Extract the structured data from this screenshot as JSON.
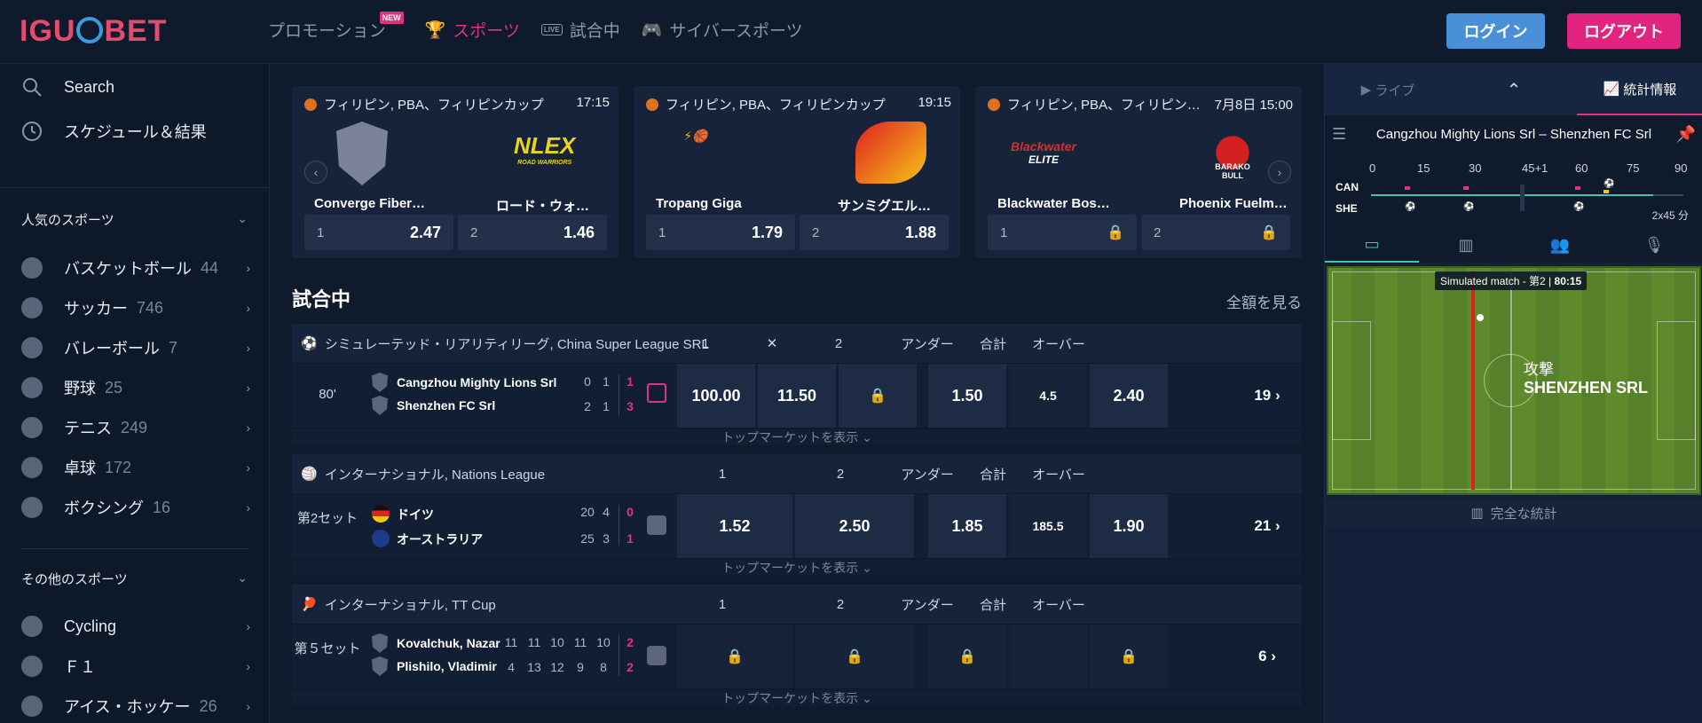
{
  "header": {
    "logo": "IGUOBET",
    "nav": [
      {
        "label": "プロモーション",
        "badge": "NEW"
      },
      {
        "label": "スポーツ"
      },
      {
        "label": "試合中",
        "badge": "LIVE"
      },
      {
        "label": "サイバースポーツ"
      }
    ],
    "login": "ログイン",
    "logout": "ログアウト"
  },
  "sidebar": {
    "search": "Search",
    "schedule": "スケジュール＆結果",
    "popular_title": "人気のスポーツ",
    "popular": [
      {
        "label": "バスケットボール",
        "count": "44"
      },
      {
        "label": "サッカー",
        "count": "746"
      },
      {
        "label": "バレーボール",
        "count": "7"
      },
      {
        "label": "野球",
        "count": "25"
      },
      {
        "label": "テニス",
        "count": "249"
      },
      {
        "label": "卓球",
        "count": "172"
      },
      {
        "label": "ボクシング",
        "count": "16"
      }
    ],
    "other_title": "その他のスポーツ",
    "other": [
      {
        "label": "Cycling",
        "count": ""
      },
      {
        "label": "Ｆ１",
        "count": ""
      },
      {
        "label": "アイス・ホッケー",
        "count": "26"
      }
    ]
  },
  "cards": [
    {
      "league": "フィリピン, PBA、フィリピンカップ",
      "time": "17:15",
      "team1": "Converge Fiber…",
      "team2": "ロード・ウォ…",
      "odd1_label": "1",
      "odd1": "2.47",
      "odd2_label": "2",
      "odd2": "1.46"
    },
    {
      "league": "フィリピン, PBA、フィリピンカップ",
      "time": "19:15",
      "team1": "Tropang Giga",
      "team2": "サンミグエル…",
      "odd1_label": "1",
      "odd1": "1.79",
      "odd2_label": "2",
      "odd2": "1.88"
    },
    {
      "league": "フィリピン, PBA、フィリピン…",
      "time": "7月8日 15:00",
      "team1": "Blackwater Bos…",
      "team2": "Phoenix Fuelm…",
      "odd1_label": "1",
      "odd1": "",
      "odd2_label": "2",
      "odd2": ""
    }
  ],
  "card_logos": {
    "nlex": "NLEX",
    "nlex_sub": "ROAD WARRIORS",
    "blackwater": "Blackwater",
    "blackwater_sub": "ELITE",
    "barako": "BARAKO BULL"
  },
  "live": {
    "title": "試合中",
    "see_all": "全額を見る",
    "top_market": "トップマーケットを表示 ⌄",
    "leagues": [
      {
        "name": "シミュレーテッド・リアリティリーグ, China Super League SRL",
        "cols": [
          "1",
          "✕",
          "2",
          "アンダー",
          "合計",
          "オーバー"
        ],
        "time": "80'",
        "team1": "Cangzhou Mighty Lions Srl",
        "team2": "Shenzhen FC Srl",
        "s1": [
          "0",
          "1",
          "1"
        ],
        "s2": [
          "2",
          "1",
          "3"
        ],
        "odds": [
          "100.00",
          "11.50",
          "",
          "1.50",
          "4.5",
          "2.40"
        ],
        "more": "19 ›"
      },
      {
        "name": "インターナショナル, Nations League",
        "cols": [
          "1",
          "2",
          "アンダー",
          "合計",
          "オーバー"
        ],
        "time": "第2セット",
        "team1": "ドイツ",
        "team2": "オーストラリア",
        "s1": [
          "20",
          "4",
          "0"
        ],
        "s2": [
          "25",
          "3",
          "1"
        ],
        "odds": [
          "1.52",
          "2.50",
          "1.85",
          "185.5",
          "1.90"
        ],
        "more": "21 ›"
      },
      {
        "name": "インターナショナル, TT Cup",
        "cols": [
          "1",
          "2",
          "アンダー",
          "合計",
          "オーバー"
        ],
        "time": "第５セット",
        "team1": "Kovalchuk, Nazar",
        "team2": "Plishilo, Vladimir",
        "s1": [
          "11",
          "11",
          "10",
          "11",
          "10",
          "2"
        ],
        "s2": [
          "4",
          "13",
          "12",
          "9",
          "8",
          "2"
        ],
        "odds": [
          "",
          "",
          "",
          "",
          ""
        ],
        "more": "6 ›"
      }
    ]
  },
  "rpanel": {
    "tab_live": "ライブ",
    "tab_stats": "統計情報",
    "match_title": "Cangzhou Mighty Lions Srl – Shenzhen FC Srl",
    "timeline_ticks": [
      "0",
      "15",
      "30",
      "45+1",
      "60",
      "75",
      "90"
    ],
    "team1_abbr": "CAN",
    "team2_abbr": "SHE",
    "duration": "2x45 分",
    "sim_label": "Simulated match - 第2",
    "sim_minute": "80:15",
    "attack_label": "攻撃",
    "attack_team": "SHENZHEN SRL",
    "full_stats": "完全な統計"
  },
  "colors": {
    "accent": "#e0337e",
    "login": "#4a90d9",
    "logout": "#e0247f",
    "pitch": "#5f8a2c",
    "live_green": "#3fc8a8"
  }
}
